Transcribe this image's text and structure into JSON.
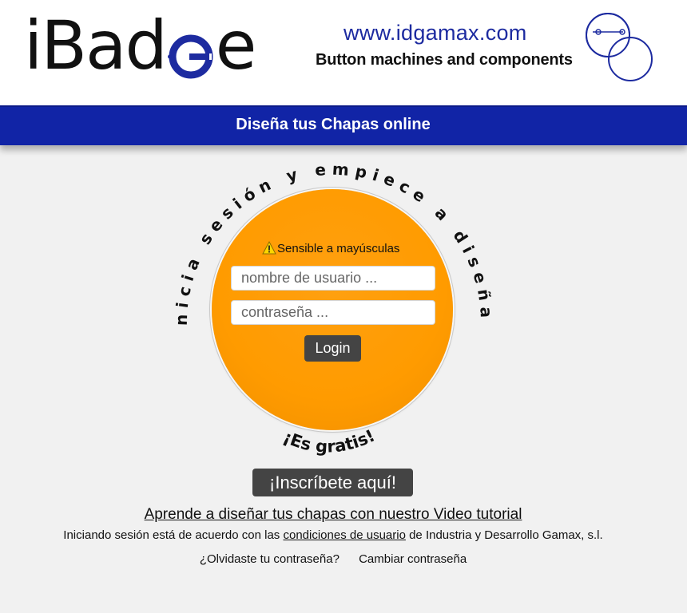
{
  "brand": {
    "logo_text_start": "iBad",
    "logo_text_end": "e",
    "logo_mark_icon": "g-circle-logo-icon",
    "site_url": "www.idgamax.com",
    "tagline": "Button machines and components",
    "circles_icon": "button-circles-icon"
  },
  "banner": {
    "title": "Diseña tus Chapas online"
  },
  "login": {
    "arc_top_text": "Inicia sesión y empiece a diseñar",
    "arc_bottom_text": "¡Es gratis!",
    "caps_warning": "Sensible a mayúsculas",
    "warning_icon": "warning-triangle-icon",
    "username_placeholder": "nombre de usuario ...",
    "username_value": "",
    "password_placeholder": "contraseña ...",
    "password_value": "",
    "login_label": "Login"
  },
  "signup": {
    "label": "¡Inscríbete aquí!"
  },
  "footer": {
    "tutorial_link": "Aprende a diseñar tus chapas con nuestro Video tutorial",
    "terms_prefix": "Iniciando sesión está de acuerdo con las ",
    "terms_link": "condiciones de usuario",
    "terms_suffix": " de Industria y Desarrollo Gamax, s.l.",
    "forgot_password": "¿Olvidaste tu contraseña?",
    "change_password": "Cambiar contraseña"
  },
  "colors": {
    "banner_blue": "#1124a6",
    "brand_blue": "#1d2ba0",
    "disc_orange": "#ff9b00",
    "button_dark": "#444444",
    "page_bg": "#f1f1f1"
  }
}
